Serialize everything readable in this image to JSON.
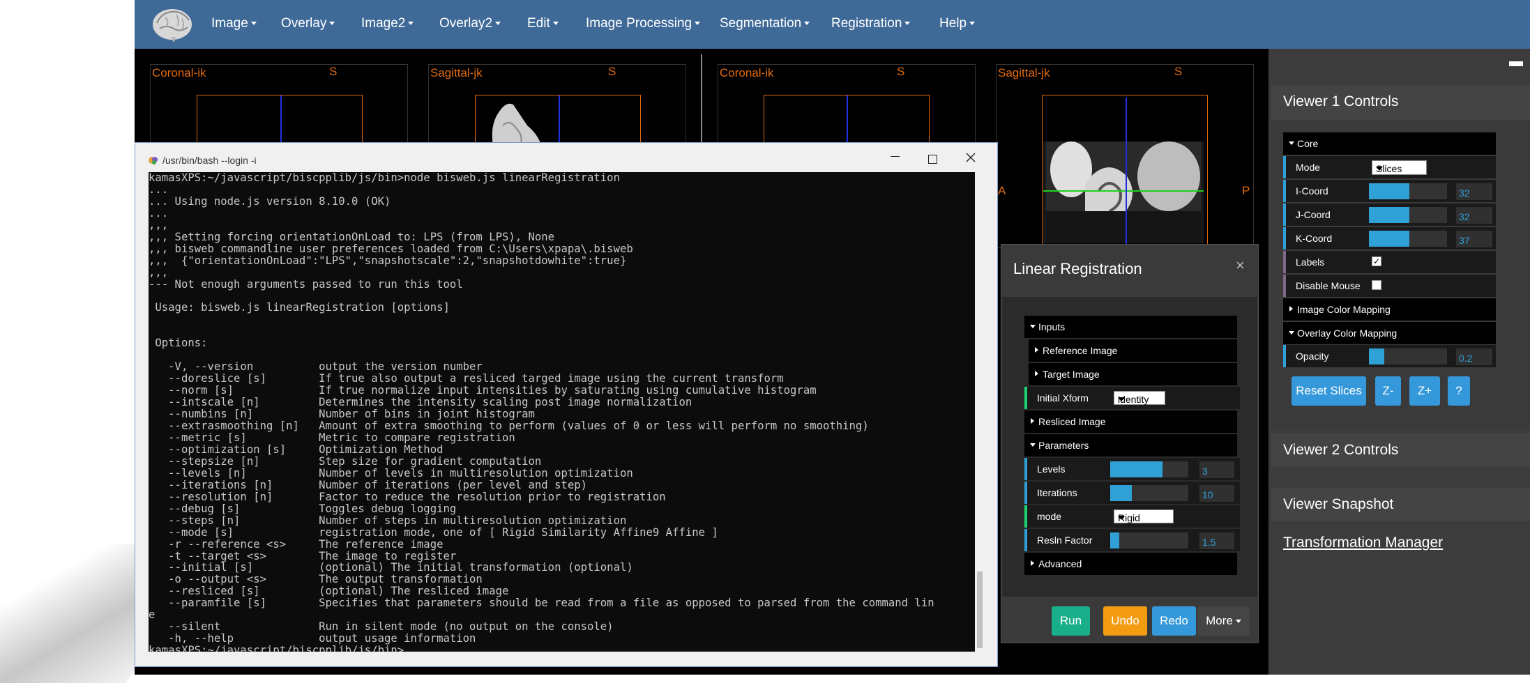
{
  "nav": {
    "items": [
      "Image",
      "Overlay",
      "Image2",
      "Overlay2",
      "Edit",
      "Image Processing",
      "Segmentation",
      "Registration",
      "Help"
    ]
  },
  "viewers": {
    "v1_left_label": "Coronal-ik",
    "v1_left_s": "S",
    "v1_right_label": "Sagittal-jk",
    "v1_right_s": "S",
    "v2_left_label": "Coronal-ik",
    "v2_left_s": "S",
    "v2_right_label": "Sagittal-jk",
    "v2_right_s": "S",
    "a_label": "A",
    "p_label": "P"
  },
  "terminal": {
    "title": "/usr/bin/bash --login -i",
    "lines": [
      "kamasXPS:~/javascript/biscpplib/js/bin>node bisweb.js linearRegistration",
      "...",
      "... Using node.js version 8.10.0 (OK)",
      "...",
      ",,,",
      ",,, Setting forcing orientationOnLoad to: LPS (from LPS), None",
      ",,, bisweb commandline user preferences loaded from C:\\Users\\xpapa\\.bisweb",
      ",,,  {\"orientationOnLoad\":\"LPS\",\"snapshotscale\":2,\"snapshotdowhite\":true}",
      ",,,",
      "--- Not enough arguments passed to run this tool",
      "",
      " Usage: bisweb.js linearRegistration [options]",
      "",
      "",
      " Options:",
      "",
      "   -V, --version          output the version number",
      "   --doreslice [s]        If true also output a resliced targed image using the current transform",
      "   --norm [s]             If true normalize input intensities by saturating using cumulative histogram",
      "   --intscale [n]         Determines the intensity scaling post image normalization",
      "   --numbins [n]          Number of bins in joint histogram",
      "   --extrasmoothing [n]   Amount of extra smoothing to perform (values of 0 or less will perform no smoothing)",
      "   --metric [s]           Metric to compare registration",
      "   --optimization [s]     Optimization Method",
      "   --stepsize [n]         Step size for gradient computation",
      "   --levels [n]           Number of levels in multiresolution optimization",
      "   --iterations [n]       Number of iterations (per level and step)",
      "   --resolution [n]       Factor to reduce the resolution prior to registration",
      "   --debug [s]            Toggles debug logging",
      "   --steps [n]            Number of steps in multiresolution optimization",
      "   --mode [s]             registration mode, one of [ Rigid Similarity Affine9 Affine ]",
      "   -r --reference <s>     The reference image",
      "   -t --target <s>        The image to register",
      "   --initial [s]          (optional) The initial transformation (optional)",
      "   -o --output <s>        The output transformation",
      "   --resliced [s]         (optional) The resliced image",
      "   --paramfile [s]        Specifies that parameters should be read from a file as opposed to parsed from the command lin",
      "e",
      "   --silent               Run in silent mode (no output on the console)",
      "   -h, --help             output usage information",
      "kamasXPS:~/javascript/biscpplib/js/bin>"
    ]
  },
  "right_panel": {
    "viewer1_title": "Viewer 1 Controls",
    "core_label": "Core",
    "mode_label": "Mode",
    "mode_value": "Slices",
    "icoord_label": "I-Coord",
    "icoord_value": "32",
    "icoord_fraction": 0.52,
    "jcoord_label": "J-Coord",
    "jcoord_value": "32",
    "jcoord_fraction": 0.52,
    "kcoord_label": "K-Coord",
    "kcoord_value": "37",
    "kcoord_fraction": 0.52,
    "labels_label": "Labels",
    "labels_checked": "✓",
    "disable_mouse_label": "Disable Mouse",
    "image_color_mapping": "Image Color Mapping",
    "overlay_color_mapping": "Overlay Color Mapping",
    "opacity_label": "Opacity",
    "opacity_value": "0.2",
    "opacity_fraction": 0.2,
    "reset_slices": "Reset Slices",
    "z_minus": "Z-",
    "z_plus": "Z+",
    "help_q": "?",
    "viewer2_title": "Viewer 2 Controls",
    "snapshot_title": "Viewer Snapshot",
    "transform_manager": "Transformation Manager"
  },
  "dialog": {
    "title": "Linear Registration",
    "close": "×",
    "inputs": "Inputs",
    "reference_image": "Reference Image",
    "target_image": "Target Image",
    "initial_xform_label": "Initial Xform",
    "initial_xform_value": "identity",
    "resliced_image": "Resliced Image",
    "parameters": "Parameters",
    "levels_label": "Levels",
    "levels_value": "3",
    "levels_fraction": 0.67,
    "iterations_label": "Iterations",
    "iterations_value": "10",
    "iterations_fraction": 0.28,
    "mode_label": "mode",
    "mode_value": "Rigid",
    "resln_label": "Resln Factor",
    "resln_value": "1.5",
    "resln_fraction": 0.12,
    "advanced": "Advanced",
    "run": "Run",
    "undo": "Undo",
    "redo": "Redo",
    "more": "More",
    "colors": {
      "run": "#1aaf8b",
      "undo": "#f39c12",
      "redo": "#3498db",
      "more": "#454545"
    }
  }
}
